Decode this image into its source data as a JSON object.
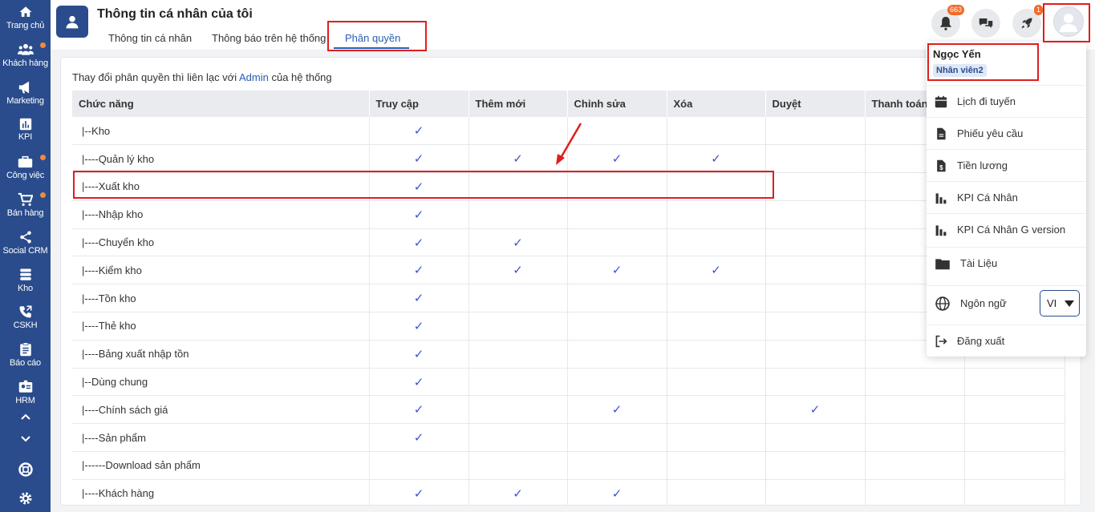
{
  "sidebar": {
    "items": [
      {
        "label": "Trang chủ",
        "icon": "home-icon"
      },
      {
        "label": "Khách hàng",
        "icon": "users-icon"
      },
      {
        "label": "Marketing",
        "icon": "megaphone-icon"
      },
      {
        "label": "KPI",
        "icon": "chart-icon"
      },
      {
        "label": "Công việc",
        "icon": "briefcase-icon"
      },
      {
        "label": "Bán hàng",
        "icon": "cart-icon"
      },
      {
        "label": "Social CRM",
        "icon": "share-icon"
      },
      {
        "label": "Kho",
        "icon": "warehouse-icon"
      },
      {
        "label": "CSKH",
        "icon": "phone-icon"
      },
      {
        "label": "Báo cáo",
        "icon": "clipboard-icon"
      },
      {
        "label": "HRM",
        "icon": "id-card-icon"
      }
    ]
  },
  "header": {
    "title": "Thông tin cá nhân của tôi",
    "tabs": [
      {
        "label": "Thông tin cá nhân"
      },
      {
        "label": "Thông báo trên hệ thống"
      },
      {
        "label": "Phân quyền"
      }
    ],
    "notification_count": "663",
    "rocket_count": "1"
  },
  "permissions": {
    "notice_before": "Thay đổi phân quyền thì liên lạc với ",
    "notice_link": "Admin",
    "notice_after": " của hệ thống",
    "columns": [
      "Chức năng",
      "Truy cập",
      "Thêm mới",
      "Chỉnh sửa",
      "Xóa",
      "Duyệt",
      "Thanh toán",
      ""
    ],
    "check_symbol": "✓",
    "rows": [
      {
        "name": "|--Kho",
        "checks": [
          true,
          false,
          false,
          false,
          false,
          false,
          false
        ]
      },
      {
        "name": "|----Quản lý kho",
        "checks": [
          true,
          true,
          true,
          true,
          false,
          false,
          false
        ]
      },
      {
        "name": "|----Xuất kho",
        "checks": [
          true,
          false,
          false,
          false,
          false,
          false,
          false
        ]
      },
      {
        "name": "|----Nhập kho",
        "checks": [
          true,
          false,
          false,
          false,
          false,
          false,
          false
        ]
      },
      {
        "name": "|----Chuyển kho",
        "checks": [
          true,
          true,
          false,
          false,
          false,
          false,
          false
        ]
      },
      {
        "name": "|----Kiểm kho",
        "checks": [
          true,
          true,
          true,
          true,
          false,
          false,
          false
        ]
      },
      {
        "name": "|----Tồn kho",
        "checks": [
          true,
          false,
          false,
          false,
          false,
          false,
          false
        ]
      },
      {
        "name": "|----Thẻ kho",
        "checks": [
          true,
          false,
          false,
          false,
          false,
          false,
          false
        ]
      },
      {
        "name": "|----Bảng xuất nhập tồn",
        "checks": [
          true,
          false,
          false,
          false,
          false,
          false,
          false
        ]
      },
      {
        "name": "|--Dùng chung",
        "checks": [
          true,
          false,
          false,
          false,
          false,
          false,
          false
        ]
      },
      {
        "name": "|----Chính sách giá",
        "checks": [
          true,
          false,
          true,
          false,
          true,
          false,
          false
        ]
      },
      {
        "name": "|----Sản phẩm",
        "checks": [
          true,
          false,
          false,
          false,
          false,
          false,
          false
        ]
      },
      {
        "name": "|------Download sản phẩm",
        "checks": [
          false,
          false,
          false,
          false,
          false,
          false,
          false
        ]
      },
      {
        "name": "|----Khách hàng",
        "checks": [
          true,
          true,
          true,
          false,
          false,
          false,
          false
        ]
      }
    ]
  },
  "user_menu": {
    "name": "Ngọc Yến",
    "role": "Nhân viên2",
    "items": [
      {
        "label": "Lịch đi tuyến",
        "icon": "calendar-icon"
      },
      {
        "label": "Phiếu yêu cầu",
        "icon": "document-icon"
      },
      {
        "label": "Tiền lương",
        "icon": "salary-icon"
      },
      {
        "label": "KPI Cá Nhân",
        "icon": "kpi-chart-icon"
      },
      {
        "label": "KPI Cá Nhân G version",
        "icon": "kpi-chart-icon"
      },
      {
        "label": "Tài Liệu",
        "icon": "folder-icon"
      },
      {
        "label": "Ngôn ngữ",
        "icon": "globe-icon"
      },
      {
        "label": "Đăng xuất",
        "icon": "logout-icon"
      }
    ],
    "language_value": "VI"
  },
  "colors": {
    "sidebar": "#2a4c8c",
    "accent": "#2a5db0",
    "check": "#3f51d6",
    "highlight": "#e01e1e",
    "badge": "#f06a2a"
  }
}
